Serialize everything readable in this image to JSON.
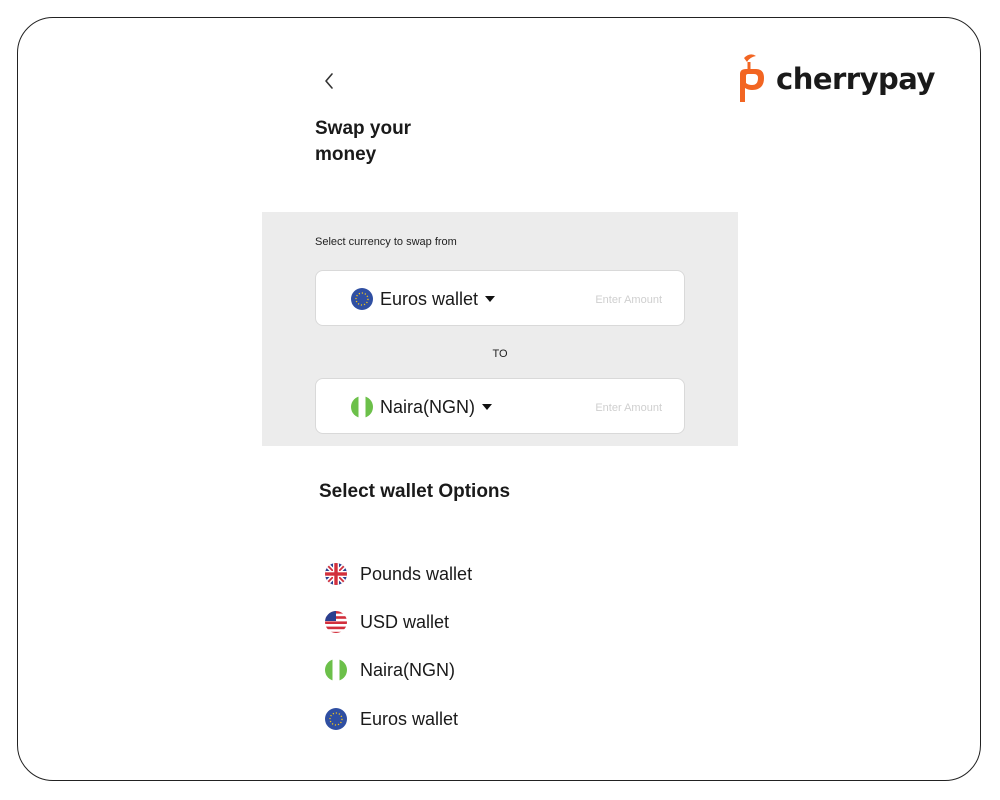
{
  "brand": {
    "name": "cherrypay",
    "accent": "#f26522"
  },
  "page": {
    "title": "Swap your money"
  },
  "swap": {
    "from_label": "Select currency to swap from",
    "from_currency": "Euros wallet",
    "amount_placeholder": "Enter Amount",
    "to_label": "TO",
    "to_currency": "Naira(NGN)",
    "to_amount_placeholder": "Enter Amount",
    "panel_color": "#ececec"
  },
  "options": {
    "title": "Select wallet Options",
    "items": [
      {
        "label": "Pounds wallet",
        "icon": "uk-flag-icon"
      },
      {
        "label": "USD wallet",
        "icon": "us-flag-icon"
      },
      {
        "label": "Naira(NGN)",
        "icon": "nigeria-flag-icon"
      },
      {
        "label": "Euros wallet",
        "icon": "eu-flag-icon"
      }
    ]
  }
}
